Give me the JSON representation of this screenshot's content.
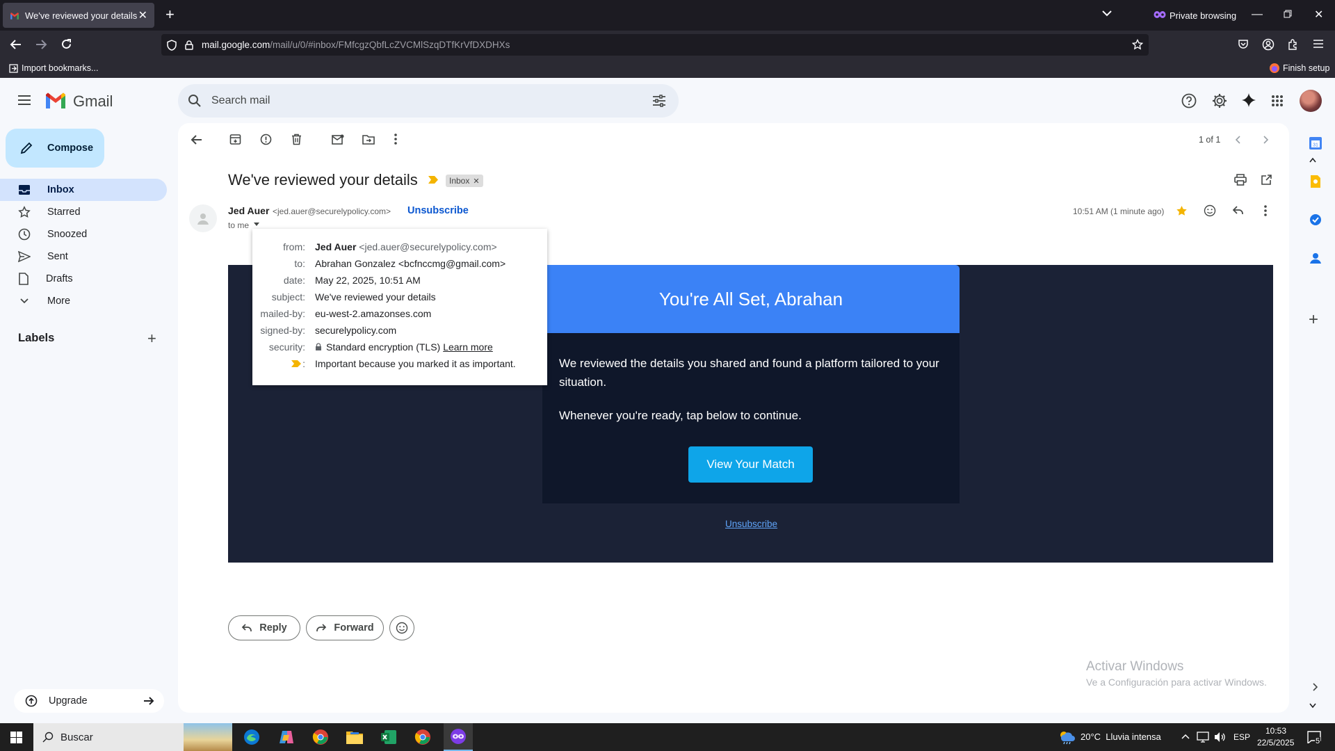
{
  "browser": {
    "tab_title": "We've reviewed your details - b",
    "private_label": "Private browsing",
    "url_host": "mail.google.com",
    "url_path": "/mail/u/0/#inbox/FMfcgzQbfLcZVCMlSzqDTfKrVfDXDHXs",
    "import_bookmarks": "Import bookmarks...",
    "finish_setup": "Finish setup"
  },
  "gmail": {
    "brand": "Gmail",
    "search_placeholder": "Search mail",
    "compose_label": "Compose",
    "nav": [
      {
        "label": "Inbox"
      },
      {
        "label": "Starred"
      },
      {
        "label": "Snoozed"
      },
      {
        "label": "Sent"
      },
      {
        "label": "Drafts"
      },
      {
        "label": "More"
      }
    ],
    "labels_heading": "Labels",
    "upgrade_label": "Upgrade",
    "pagination": "1 of 1"
  },
  "email": {
    "subject": "We've reviewed your details",
    "inbox_chip": "Inbox",
    "sender_name": "Jed Auer",
    "sender_email": "<jed.auer@securelypolicy.com>",
    "unsubscribe_link": "Unsubscribe",
    "to_me": "to me",
    "time": "10:51 AM (1 minute ago)",
    "details": {
      "from_k": "from:",
      "from_name": "Jed Auer",
      "from_email": "<jed.auer@securelypolicy.com>",
      "to_k": "to:",
      "to_v": "Abrahan Gonzalez <bcfnccmg@gmail.com>",
      "date_k": "date:",
      "date_v": "May 22, 2025, 10:51 AM",
      "subject_k": "subject:",
      "subject_v": "We've reviewed your details",
      "mailed_k": "mailed-by:",
      "mailed_v": "eu-west-2.amazonses.com",
      "signed_k": "signed-by:",
      "signed_v": "securelypolicy.com",
      "security_k": "security:",
      "security_v": "Standard encryption (TLS)",
      "learn_more": "Learn more",
      "important_v": "Important because you marked it as important."
    },
    "body": {
      "heading": "You're All Set, Abrahan",
      "p1": "We reviewed the details you shared and found a platform tailored to your situation.",
      "p2": "Whenever you're ready, tap below to continue.",
      "cta": "View Your Match",
      "footer_unsubscribe": "Unsubscribe"
    },
    "reply_label": "Reply",
    "forward_label": "Forward"
  },
  "watermark": {
    "line1": "Activar Windows",
    "line2": "Ve a Configuración para activar Windows."
  },
  "taskbar": {
    "search_placeholder": "Buscar",
    "weather": "20°C  Lluvia intensa",
    "lang": "ESP",
    "time": "10:53",
    "date": "22/5/2025",
    "notif_count": "5"
  },
  "colors": {
    "accent": "#0b57d0",
    "compose_bg": "#c2e7ff",
    "email_header": "#3b82f6",
    "cta": "#0ea5e9",
    "important": "#f4b400"
  }
}
